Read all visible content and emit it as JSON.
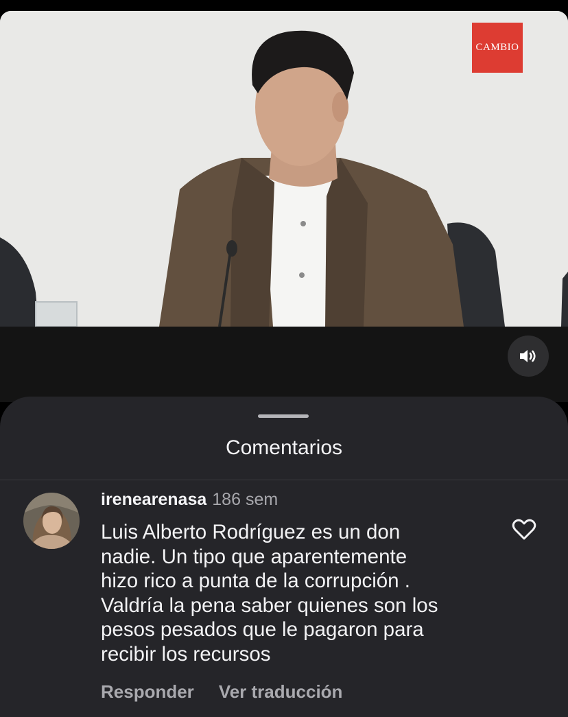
{
  "video": {
    "brand_logo_text": "CAMBIO",
    "background_color": "#e9e9e7",
    "audio_icon": "speaker-volume-icon"
  },
  "comments_sheet": {
    "title": "Comentarios",
    "background_color": "#252529",
    "comments": [
      {
        "username": "irenearenasa",
        "time": "186 sem",
        "text": "Luis Alberto Rodríguez es un don\nnadie. Un tipo que aparentemente\nhizo rico a punta de la corrupción .\nValdría la pena saber quienes son los\npesos pesados que le pagaron para\nrecibir los recursos",
        "reply_label": "Responder",
        "translate_label": "Ver traducción",
        "like_icon": "heart-outline-icon"
      }
    ]
  }
}
